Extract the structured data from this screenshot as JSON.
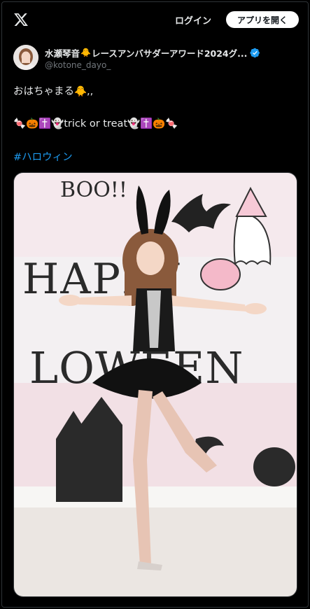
{
  "topbar": {
    "logo_icon": "x-logo-icon",
    "login_label": "ログイン",
    "open_app_label": "アプリを開く"
  },
  "author": {
    "name_part1": "水瀬琴音",
    "name_emoji": "🐥",
    "name_part2": "レースアンバサダーアワード2024グ...",
    "verified_color": "#1d9bf0",
    "handle": "@kotone_dayo_"
  },
  "post": {
    "line1": "おはちゃまる🐥,,",
    "line2": "🍬🎃✝️👻trick or treat👻✝️🎃🍬",
    "hashtag": "#ハロウィン"
  },
  "media": {
    "banner_text_top": "BOO!!",
    "banner_text_happy": "HAPPY",
    "banner_text_halloween": "LOWEEN"
  },
  "colors": {
    "background": "#000000",
    "text": "#e7e9ea",
    "muted": "#71767b",
    "link": "#1d9bf0"
  }
}
